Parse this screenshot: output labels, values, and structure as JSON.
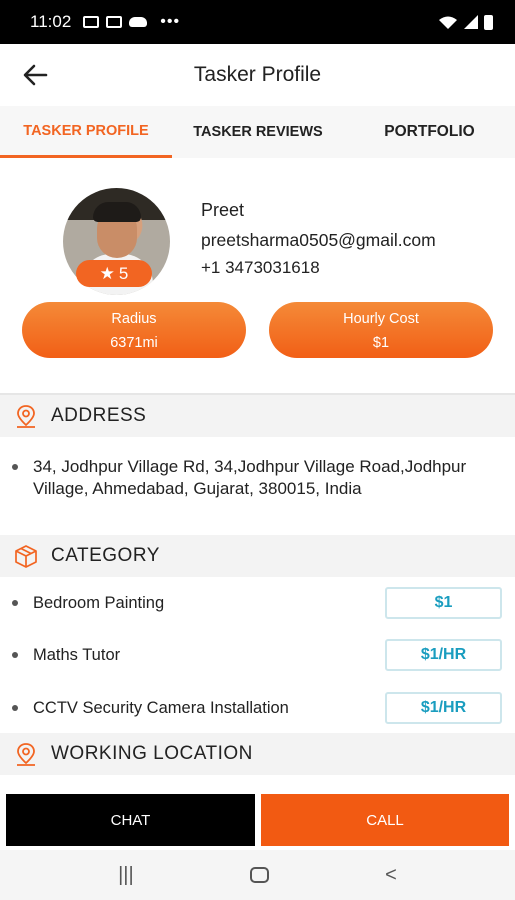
{
  "status_bar": {
    "time": "11:02",
    "more": "•••"
  },
  "appbar": {
    "title": "Tasker Profile",
    "back_icon": "back-arrow-icon"
  },
  "tabs": [
    {
      "label": "TASKER PROFILE",
      "active": true
    },
    {
      "label": "TASKER REVIEWS",
      "active": false
    },
    {
      "label": "PORTFOLIO",
      "active": false
    }
  ],
  "profile": {
    "name": "Preet",
    "email": "preetsharma0505@gmail.com",
    "phone": "+1 3473031618",
    "rating_star": "★",
    "rating": "5",
    "radius_label": "Radius",
    "radius_value": "6371mi",
    "cost_label": "Hourly Cost",
    "cost_value": "$1"
  },
  "address": {
    "title": "ADDRESS",
    "text": "34, Jodhpur Village Rd, 34,Jodhpur Village Road,Jodhpur Village, Ahmedabad, Gujarat, 380015, India"
  },
  "category": {
    "title": "CATEGORY",
    "items": [
      {
        "name": "Bedroom Painting",
        "price": "$1"
      },
      {
        "name": "Maths Tutor",
        "price": "$1/HR"
      },
      {
        "name": "CCTV Security Camera Installation",
        "price": "$1/HR"
      }
    ]
  },
  "working_location": {
    "title": "WORKING LOCATION"
  },
  "actions": {
    "chat": "CHAT",
    "call": "CALL"
  },
  "nav": {
    "recent": "|||",
    "back": "<"
  },
  "colors": {
    "accent": "#f26522",
    "price_text": "#1a9dbf",
    "chat_bg": "#000000"
  }
}
